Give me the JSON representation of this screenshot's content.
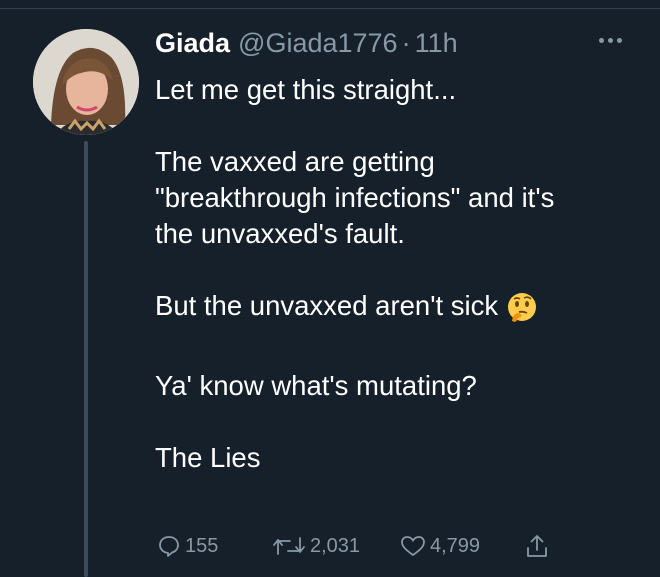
{
  "tweet": {
    "display_name": "Giada",
    "handle": "@Giada1776",
    "separator": "·",
    "timestamp": "11h",
    "lines": {
      "l1": "Let me get this straight...",
      "l2": "The vaxxed are getting",
      "l3": "\"breakthrough infections\" and it's",
      "l4": "the unvaxxed's fault.",
      "l5": "But the unvaxxed aren't sick",
      "l6": "Ya' know what's mutating?",
      "l7": "The Lies"
    },
    "emoji": "thinking-face"
  },
  "actions": {
    "replies": "155",
    "retweets": "2,031",
    "likes": "4,799"
  },
  "colors": {
    "background": "#15202b",
    "text": "#ffffff",
    "secondary": "#8899a6"
  }
}
